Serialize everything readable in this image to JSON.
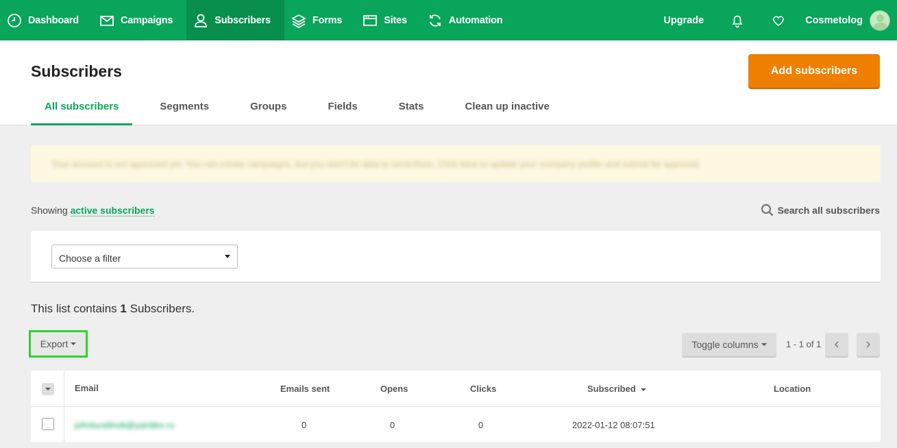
{
  "nav": {
    "items": [
      {
        "label": "Dashboard",
        "icon": "dashboard-icon"
      },
      {
        "label": "Campaigns",
        "icon": "envelope-icon"
      },
      {
        "label": "Subscribers",
        "icon": "user-icon",
        "active": true
      },
      {
        "label": "Forms",
        "icon": "layers-icon"
      },
      {
        "label": "Sites",
        "icon": "browser-icon"
      },
      {
        "label": "Automation",
        "icon": "refresh-icon"
      }
    ],
    "upgrade": "Upgrade",
    "user_name": "Cosmetolog"
  },
  "header": {
    "title": "Subscribers",
    "add_button": "Add subscribers",
    "tabs": [
      "All subscribers",
      "Segments",
      "Groups",
      "Fields",
      "Stats",
      "Clean up inactive"
    ]
  },
  "notice": {
    "text": "Your account is not approved yet. You can create campaigns, but you won't be able to send them. Click here to update your company profile and submit for approval."
  },
  "filter_bar": {
    "showing_label": "Showing",
    "showing_link": "active subscribers",
    "search_all": "Search all subscribers",
    "filter_placeholder": "Choose a filter"
  },
  "summary": {
    "prefix": "This list contains",
    "count": "1",
    "suffix": "Subscribers."
  },
  "toolbar": {
    "export": "Export",
    "toggle_columns": "Toggle columns",
    "pager": "1 - 1 of 1"
  },
  "table": {
    "columns": [
      "Email",
      "Emails sent",
      "Opens",
      "Clicks",
      "Subscribed",
      "Location"
    ],
    "rows": [
      {
        "email": "johnlucelinok@yandex.ru",
        "emails_sent": "0",
        "opens": "0",
        "clicks": "0",
        "subscribed": "2022-01-12 08:07:51",
        "location": ""
      }
    ]
  },
  "colors": {
    "brand_green": "#09a55a",
    "accent_orange": "#ef7f00"
  }
}
